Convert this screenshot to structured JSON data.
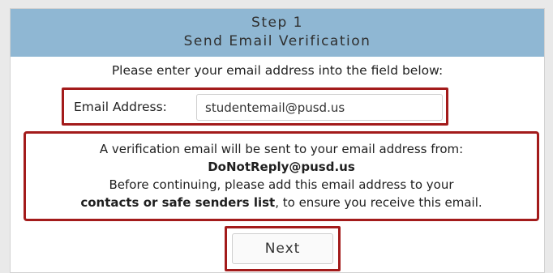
{
  "header": {
    "step": "Step 1",
    "subtitle": "Send Email Verification"
  },
  "instruction": "Please enter your email address into the field below:",
  "email": {
    "label": "Email Address:",
    "value": "studentemail@pusd.us"
  },
  "notice": {
    "line1": "A verification email will be sent to your email address from:",
    "sender": "DoNotReply@pusd.us",
    "line3": "Before continuing, please add this email address to your",
    "emphasis": "contacts or safe senders list",
    "line4_rest": ", to ensure you receive this email."
  },
  "next_button": {
    "label": "Next"
  },
  "colors": {
    "header_bg": "#8fb7d3",
    "highlight": "#a31b1b"
  }
}
